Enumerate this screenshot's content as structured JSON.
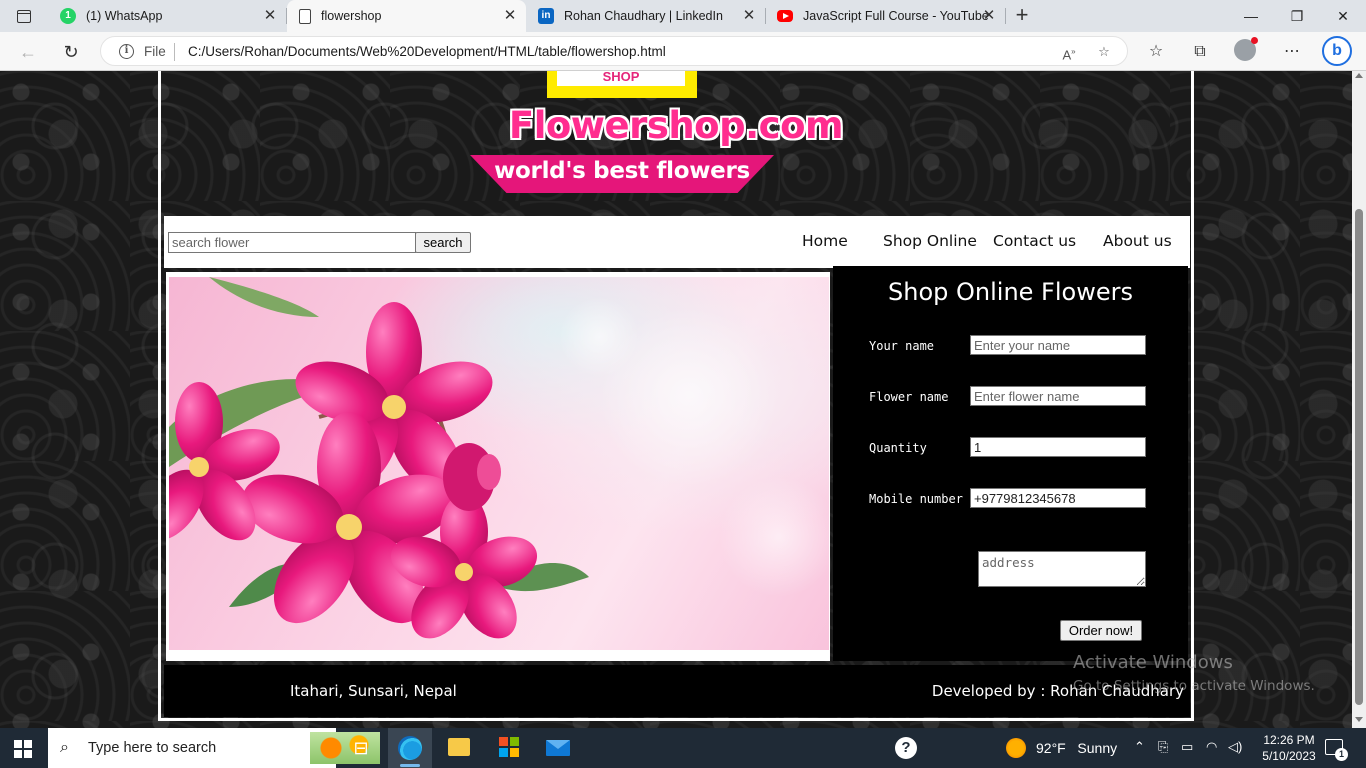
{
  "browser": {
    "tabs": [
      {
        "title": "(1) WhatsApp",
        "icon": "whatsapp-icon",
        "active": false
      },
      {
        "title": "flowershop",
        "icon": "document-icon",
        "active": true
      },
      {
        "title": "Rohan Chaudhary | LinkedIn",
        "icon": "linkedin-icon",
        "active": false
      },
      {
        "title": "JavaScript Full Course - YouTube",
        "icon": "youtube-icon",
        "active": false
      }
    ],
    "file_label": "File",
    "url": "C:/Users/Rohan/Documents/Web%20Development/HTML/table/flowershop.html"
  },
  "site": {
    "logo_text": "SHOP",
    "brand": "Flowershop.com",
    "tagline": "world's best flowers",
    "search": {
      "placeholder": "search flower",
      "button_label": "search"
    },
    "nav": {
      "home": "Home",
      "shop": "Shop Online",
      "contact": "Contact us",
      "about": "About us"
    },
    "order_form": {
      "title": "Shop Online Flowers",
      "name_label": "Your name",
      "name_placeholder": "Enter your name",
      "flower_label": "Flower name",
      "flower_placeholder": "Enter flower name",
      "quantity_label": "Quantity",
      "quantity_value": "1",
      "mobile_label": "Mobile number",
      "mobile_value": "+9779812345678",
      "address_placeholder": "address",
      "submit_label": "Order now!"
    },
    "footer": {
      "address": "Itahari, Sunsari, Nepal",
      "developer": "Developed by : Rohan Chaudhary"
    }
  },
  "watermark": {
    "line1": "Activate Windows",
    "line2": "Go to Settings to activate Windows."
  },
  "taskbar": {
    "search_placeholder": "Type here to search",
    "weather_temp": "92°F",
    "weather_text": "Sunny",
    "time": "12:26 PM",
    "date": "5/10/2023",
    "notification_count": "1"
  }
}
